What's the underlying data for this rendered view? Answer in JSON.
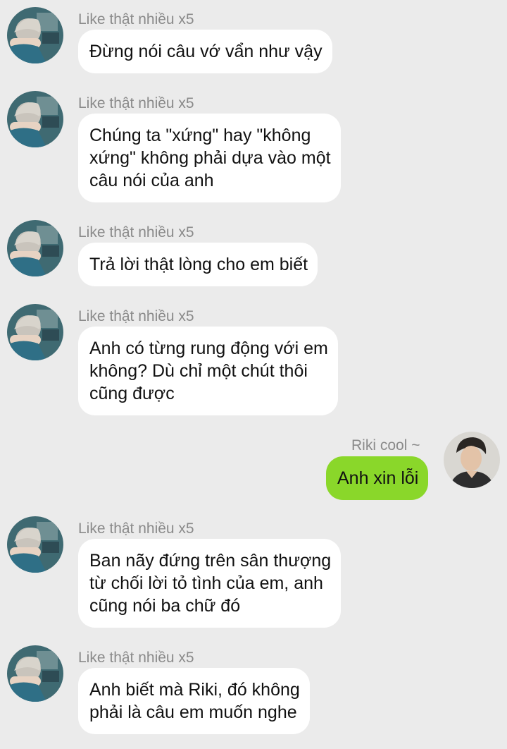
{
  "colors": {
    "background": "#ebebeb",
    "incoming_bubble": "#ffffff",
    "outgoing_bubble": "#8ad72a",
    "sender_name": "#8a8a8a"
  },
  "messages": [
    {
      "direction": "incoming",
      "sender": "Like thật nhiều x5",
      "avatar": "avatar-girl-icon",
      "lines": [
        "Đừng nói câu vớ vẩn như vậy"
      ]
    },
    {
      "direction": "incoming",
      "sender": "Like thật nhiều x5",
      "avatar": "avatar-girl-icon",
      "lines": [
        "Chúng ta \"xứng\" hay \"không",
        "xứng\" không phải dựa vào một",
        "câu nói của anh"
      ]
    },
    {
      "direction": "incoming",
      "sender": "Like thật nhiều x5",
      "avatar": "avatar-girl-icon",
      "lines": [
        "Trả lời thật lòng cho em biết"
      ]
    },
    {
      "direction": "incoming",
      "sender": "Like thật nhiều x5",
      "avatar": "avatar-girl-icon",
      "lines": [
        "Anh có từng rung động với em",
        "không? Dù chỉ một chút thôi",
        "cũng được"
      ]
    },
    {
      "direction": "outgoing",
      "sender": "Riki cool ~",
      "avatar": "avatar-boy-icon",
      "lines": [
        "Anh xin lỗi"
      ]
    },
    {
      "direction": "incoming",
      "sender": "Like thật nhiều x5",
      "avatar": "avatar-girl-icon",
      "lines": [
        "Ban nãy đứng trên sân thượng",
        "từ chối lời tỏ tình của em, anh",
        "cũng nói ba chữ đó"
      ]
    },
    {
      "direction": "incoming",
      "sender": "Like thật nhiều x5",
      "avatar": "avatar-girl-icon",
      "lines": [
        "Anh biết mà Riki, đó không",
        "phải là câu em muốn nghe"
      ]
    }
  ]
}
